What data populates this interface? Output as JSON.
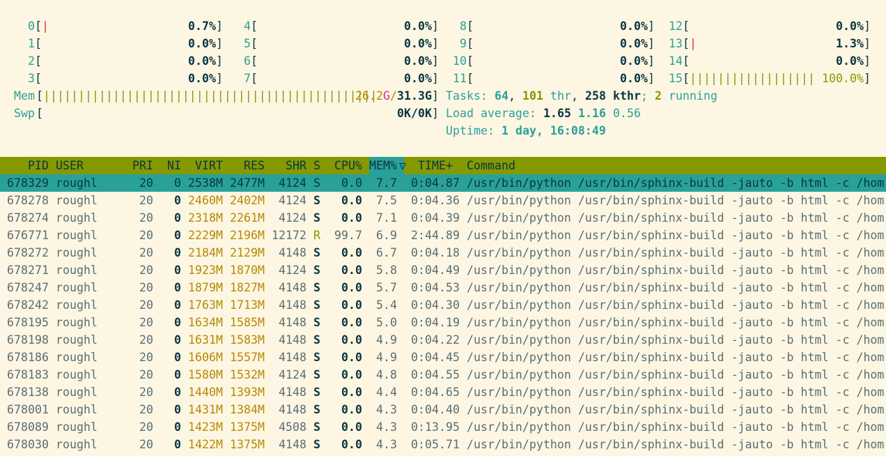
{
  "cpus": [
    {
      "id": "0",
      "bar": "|",
      "pct": "0.7%"
    },
    {
      "id": "1",
      "bar": "",
      "pct": "0.0%"
    },
    {
      "id": "2",
      "bar": "",
      "pct": "0.0%"
    },
    {
      "id": "3",
      "bar": "",
      "pct": "0.0%"
    },
    {
      "id": "4",
      "bar": "",
      "pct": "0.0%"
    },
    {
      "id": "5",
      "bar": "",
      "pct": "0.0%"
    },
    {
      "id": "6",
      "bar": "",
      "pct": "0.0%"
    },
    {
      "id": "7",
      "bar": "",
      "pct": "0.0%"
    },
    {
      "id": "8",
      "bar": "",
      "pct": "0.0%"
    },
    {
      "id": "9",
      "bar": "",
      "pct": "0.0%"
    },
    {
      "id": "10",
      "bar": "",
      "pct": "0.0%"
    },
    {
      "id": "11",
      "bar": "",
      "pct": "0.0%"
    },
    {
      "id": "12",
      "bar": "",
      "pct": "0.0%"
    },
    {
      "id": "13",
      "bar": "|",
      "pct": "1.3%"
    },
    {
      "id": "14",
      "bar": "",
      "pct": "0.0%"
    },
    {
      "id": "15",
      "bar": "||||||||||||||||||",
      "pct": "100.0%"
    }
  ],
  "mem": {
    "label": "Mem",
    "bar": "||||||||||||||||||||||||||||||||||||||||||||||||",
    "used": "26.2",
    "used_unit": "G",
    "sep": "/",
    "total": "31.3G"
  },
  "swp": {
    "label": "Swp",
    "value": "0K/0K"
  },
  "tasks": {
    "label": "Tasks:",
    "tasks": "64",
    "thr": "101",
    "thr_label": "thr",
    "kthr": "258",
    "kthr_label": "kthr",
    "running": "2",
    "running_label": "running"
  },
  "load": {
    "label": "Load average:",
    "one": "1.65",
    "five": "1.16",
    "fifteen": "0.56"
  },
  "uptime": {
    "label": "Uptime:",
    "value": "1 day, 16:08:49"
  },
  "columns": [
    "PID",
    "USER",
    "PRI",
    "NI",
    "VIRT",
    "RES",
    "SHR",
    "S",
    "CPU%",
    "MEM%",
    "▽",
    "TIME+",
    "Command"
  ],
  "processes": [
    {
      "pid": "678329",
      "user": "roughl",
      "pri": "20",
      "ni": "0",
      "virt": "2538M",
      "res": "2477M",
      "shr": "4124",
      "s": "S",
      "cpu": "0.0",
      "mem": "7.7",
      "time": "0:04.87",
      "cmd": "/usr/bin/python /usr/bin/sphinx-build -jauto -b html -c /hom"
    },
    {
      "pid": "678278",
      "user": "roughl",
      "pri": "20",
      "ni": "0",
      "virt": "2460M",
      "res": "2402M",
      "shr": "4124",
      "s": "S",
      "cpu": "0.0",
      "mem": "7.5",
      "time": "0:04.36",
      "cmd": "/usr/bin/python /usr/bin/sphinx-build -jauto -b html -c /hom"
    },
    {
      "pid": "678274",
      "user": "roughl",
      "pri": "20",
      "ni": "0",
      "virt": "2318M",
      "res": "2261M",
      "shr": "4124",
      "s": "S",
      "cpu": "0.0",
      "mem": "7.1",
      "time": "0:04.39",
      "cmd": "/usr/bin/python /usr/bin/sphinx-build -jauto -b html -c /hom"
    },
    {
      "pid": "676771",
      "user": "roughl",
      "pri": "20",
      "ni": "0",
      "virt": "2229M",
      "res": "2196M",
      "shr": "12172",
      "s": "R",
      "cpu": "99.7",
      "mem": "6.9",
      "time": "2:44.89",
      "cmd": "/usr/bin/python /usr/bin/sphinx-build -jauto -b html -c /hom"
    },
    {
      "pid": "678272",
      "user": "roughl",
      "pri": "20",
      "ni": "0",
      "virt": "2184M",
      "res": "2129M",
      "shr": "4148",
      "s": "S",
      "cpu": "0.0",
      "mem": "6.7",
      "time": "0:04.18",
      "cmd": "/usr/bin/python /usr/bin/sphinx-build -jauto -b html -c /hom"
    },
    {
      "pid": "678271",
      "user": "roughl",
      "pri": "20",
      "ni": "0",
      "virt": "1923M",
      "res": "1870M",
      "shr": "4124",
      "s": "S",
      "cpu": "0.0",
      "mem": "5.8",
      "time": "0:04.49",
      "cmd": "/usr/bin/python /usr/bin/sphinx-build -jauto -b html -c /hom"
    },
    {
      "pid": "678247",
      "user": "roughl",
      "pri": "20",
      "ni": "0",
      "virt": "1879M",
      "res": "1827M",
      "shr": "4148",
      "s": "S",
      "cpu": "0.0",
      "mem": "5.7",
      "time": "0:04.53",
      "cmd": "/usr/bin/python /usr/bin/sphinx-build -jauto -b html -c /hom"
    },
    {
      "pid": "678242",
      "user": "roughl",
      "pri": "20",
      "ni": "0",
      "virt": "1763M",
      "res": "1713M",
      "shr": "4148",
      "s": "S",
      "cpu": "0.0",
      "mem": "5.4",
      "time": "0:04.30",
      "cmd": "/usr/bin/python /usr/bin/sphinx-build -jauto -b html -c /hom"
    },
    {
      "pid": "678195",
      "user": "roughl",
      "pri": "20",
      "ni": "0",
      "virt": "1634M",
      "res": "1585M",
      "shr": "4148",
      "s": "S",
      "cpu": "0.0",
      "mem": "5.0",
      "time": "0:04.19",
      "cmd": "/usr/bin/python /usr/bin/sphinx-build -jauto -b html -c /hom"
    },
    {
      "pid": "678198",
      "user": "roughl",
      "pri": "20",
      "ni": "0",
      "virt": "1631M",
      "res": "1583M",
      "shr": "4148",
      "s": "S",
      "cpu": "0.0",
      "mem": "4.9",
      "time": "0:04.22",
      "cmd": "/usr/bin/python /usr/bin/sphinx-build -jauto -b html -c /hom"
    },
    {
      "pid": "678186",
      "user": "roughl",
      "pri": "20",
      "ni": "0",
      "virt": "1606M",
      "res": "1557M",
      "shr": "4148",
      "s": "S",
      "cpu": "0.0",
      "mem": "4.9",
      "time": "0:04.45",
      "cmd": "/usr/bin/python /usr/bin/sphinx-build -jauto -b html -c /hom"
    },
    {
      "pid": "678183",
      "user": "roughl",
      "pri": "20",
      "ni": "0",
      "virt": "1580M",
      "res": "1532M",
      "shr": "4124",
      "s": "S",
      "cpu": "0.0",
      "mem": "4.8",
      "time": "0:04.55",
      "cmd": "/usr/bin/python /usr/bin/sphinx-build -jauto -b html -c /hom"
    },
    {
      "pid": "678138",
      "user": "roughl",
      "pri": "20",
      "ni": "0",
      "virt": "1440M",
      "res": "1393M",
      "shr": "4148",
      "s": "S",
      "cpu": "0.0",
      "mem": "4.4",
      "time": "0:04.65",
      "cmd": "/usr/bin/python /usr/bin/sphinx-build -jauto -b html -c /hom"
    },
    {
      "pid": "678001",
      "user": "roughl",
      "pri": "20",
      "ni": "0",
      "virt": "1431M",
      "res": "1384M",
      "shr": "4148",
      "s": "S",
      "cpu": "0.0",
      "mem": "4.3",
      "time": "0:04.40",
      "cmd": "/usr/bin/python /usr/bin/sphinx-build -jauto -b html -c /hom"
    },
    {
      "pid": "678089",
      "user": "roughl",
      "pri": "20",
      "ni": "0",
      "virt": "1423M",
      "res": "1375M",
      "shr": "4508",
      "s": "S",
      "cpu": "0.0",
      "mem": "4.3",
      "time": "0:13.95",
      "cmd": "/usr/bin/python /usr/bin/sphinx-build -jauto -b html -c /hom"
    },
    {
      "pid": "678030",
      "user": "roughl",
      "pri": "20",
      "ni": "0",
      "virt": "1422M",
      "res": "1375M",
      "shr": "4148",
      "s": "S",
      "cpu": "0.0",
      "mem": "4.3",
      "time": "0:05.71",
      "cmd": "/usr/bin/python /usr/bin/sphinx-build -jauto -b html -c /hom"
    }
  ]
}
